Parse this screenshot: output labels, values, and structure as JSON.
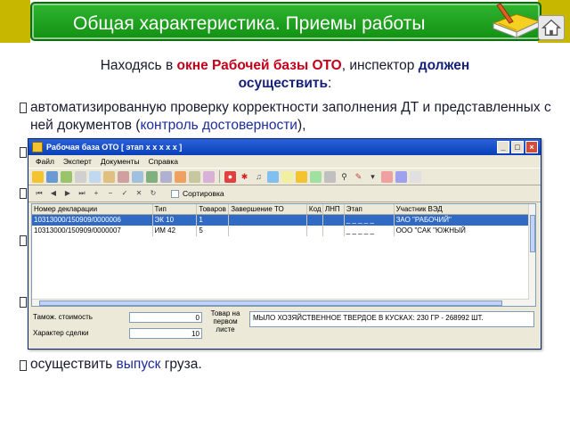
{
  "slide": {
    "title": "Общая характеристика.  Приемы работы"
  },
  "intro": {
    "part1": "Находясь в ",
    "part2": "окне Рабочей базы ОТО",
    "part3": ", инспектор ",
    "part4": "должен осуществить",
    "part5": ":"
  },
  "bullets": {
    "b1_text": "автоматизированную проверку корректности заполнения ДТ и представленных с ней документов (",
    "b1_highlight": "контроль достоверности",
    "b1_end": "),",
    "last_part1": "осуществить ",
    "last_highlight": "выпуск",
    "last_part2": " груза."
  },
  "window": {
    "title": "Рабочая база ОТО  [ этап x x x x x ]",
    "menu": [
      "Файл",
      "Эксперт",
      "Документы",
      "Справка"
    ],
    "sort_label": "Сортировка",
    "columns": [
      "Номер декларации",
      "Тип",
      "Товаров",
      "Завершение ТО",
      "Код",
      "ЛНП",
      "Этап",
      "Участник ВЭД"
    ],
    "rows": [
      [
        "10313000/150909/0000006",
        "ЭК 10",
        "1",
        "",
        "",
        "",
        "_ _ _ _ _",
        "ЗАО \"РАБОЧИЙ\""
      ],
      [
        "10313000/150909/0000007",
        "ИМ 42",
        "5",
        "",
        "",
        "",
        "_ _ _ _ _",
        "ООО \"САК \"ЮЖНЫЙ"
      ]
    ],
    "bottom": {
      "customs_value_label": "Тамож. стоимость",
      "customs_value": "0",
      "deal_label": "Характер сделки",
      "deal_value": "10",
      "goods_label": "Товар на первом листе",
      "goods_value": "МЫЛО ХОЗЯЙСТВЕННОЕ ТВЕРДОЕ В КУСКАХ: 230 ГР - 268992 ШТ."
    }
  },
  "colors": {
    "title_bg": "#139013",
    "band": "#c7b700",
    "highlight_red": "#c4001a",
    "highlight_blue": "#1d2d9e"
  }
}
